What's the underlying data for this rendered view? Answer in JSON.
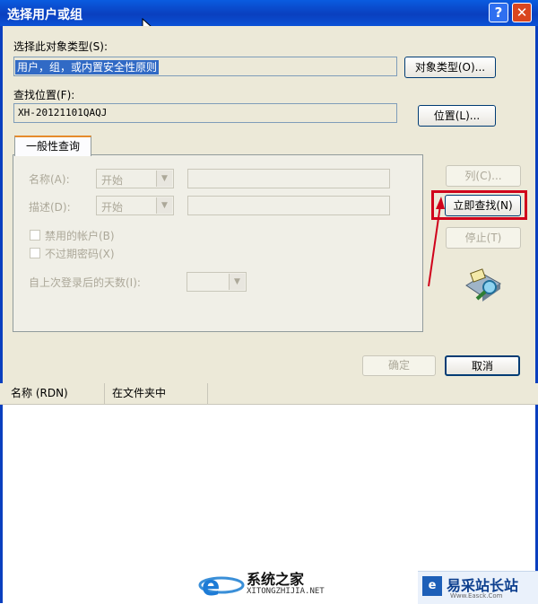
{
  "window": {
    "title": "选择用户或组",
    "help_glyph": "?",
    "close_glyph": "✕"
  },
  "object_type": {
    "label": "选择此对象类型(S):",
    "value": "用户，组，或内置安全性原则",
    "button": "对象类型(O)..."
  },
  "location": {
    "label": "查找位置(F):",
    "value": "XH-20121101QAQJ",
    "button": "位置(L)..."
  },
  "tab": {
    "label": "一般性查询"
  },
  "query": {
    "name_label": "名称(A):",
    "name_op": "开始",
    "desc_label": "描述(D):",
    "desc_op": "开始",
    "disabled_accounts": "禁用的帐户(B)",
    "no_expire_password": "不过期密码(X)",
    "days_since_login_label": "自上次登录后的天数(I):"
  },
  "side_buttons": {
    "columns": "列(C)...",
    "find_now": "立即查找(N)",
    "stop": "停止(T)"
  },
  "footer_buttons": {
    "ok": "确定",
    "cancel": "取消"
  },
  "results": {
    "columns": [
      "名称 (RDN)",
      "在文件夹中"
    ]
  },
  "watermarks": {
    "site1_name": "系统之家",
    "site1_url": "XITONGZHIJIA.NET",
    "site2_name": "易采站长站",
    "site2_sub": "Www.Easck.Com"
  },
  "colors": {
    "highlight_box": "#d0021b",
    "titlebar": "#0a3fbf",
    "dialog_bg": "#ece9d8"
  }
}
